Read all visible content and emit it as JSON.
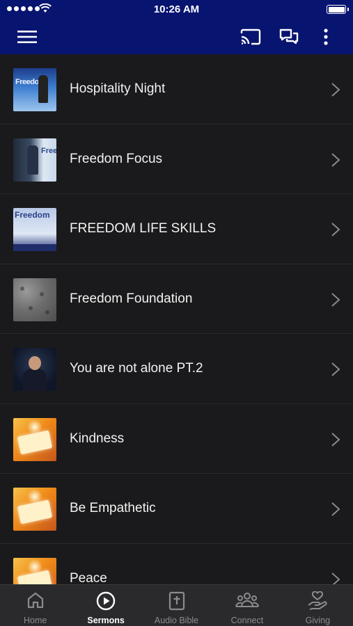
{
  "status_bar": {
    "time": "10:26 AM"
  },
  "app_bar": {
    "icons": [
      "menu-icon",
      "cast-icon",
      "chat-icon",
      "more-vertical-icon"
    ],
    "color": "#071470"
  },
  "sermons": [
    {
      "title": "Hospitality Night",
      "thumb_text": "Freedom"
    },
    {
      "title": "Freedom Focus",
      "thumb_text": "Freed"
    },
    {
      "title": "FREEDOM LIFE SKILLS",
      "thumb_text": "Freedom"
    },
    {
      "title": "Freedom Foundation"
    },
    {
      "title": "You are not alone PT.2"
    },
    {
      "title": "Kindness"
    },
    {
      "title": "Be Empathetic"
    },
    {
      "title": "Peace"
    }
  ],
  "bottom_nav": {
    "tabs": [
      {
        "label": "Home",
        "icon": "home-icon"
      },
      {
        "label": "Sermons",
        "icon": "play-circle-icon",
        "active": true
      },
      {
        "label": "Audio Bible",
        "icon": "bible-icon"
      },
      {
        "label": "Connect",
        "icon": "people-icon"
      },
      {
        "label": "Giving",
        "icon": "giving-hand-icon"
      }
    ]
  }
}
